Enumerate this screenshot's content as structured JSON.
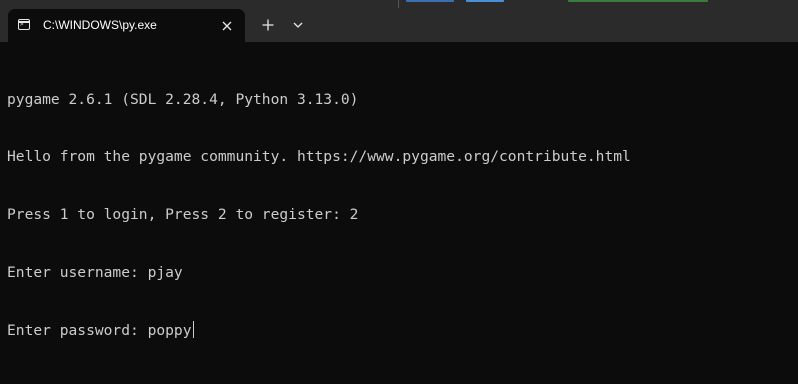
{
  "window": {
    "tab_title": "C:\\WINDOWS\\py.exe",
    "tab_icon": "terminal-icon",
    "close_icon": "close-icon",
    "new_tab_icon": "plus-icon",
    "dropdown_icon": "chevron-down-icon"
  },
  "console": {
    "lines": [
      "pygame 2.6.1 (SDL 2.28.4, Python 3.13.0)",
      "Hello from the pygame community. https://www.pygame.org/contribute.html",
      "Press 1 to login, Press 2 to register: 2",
      "Enter username: pjay",
      "Enter password: poppy"
    ]
  },
  "colors": {
    "background": "#0c0c0c",
    "titlebar": "#2b2b2b",
    "text": "#cccccc"
  }
}
